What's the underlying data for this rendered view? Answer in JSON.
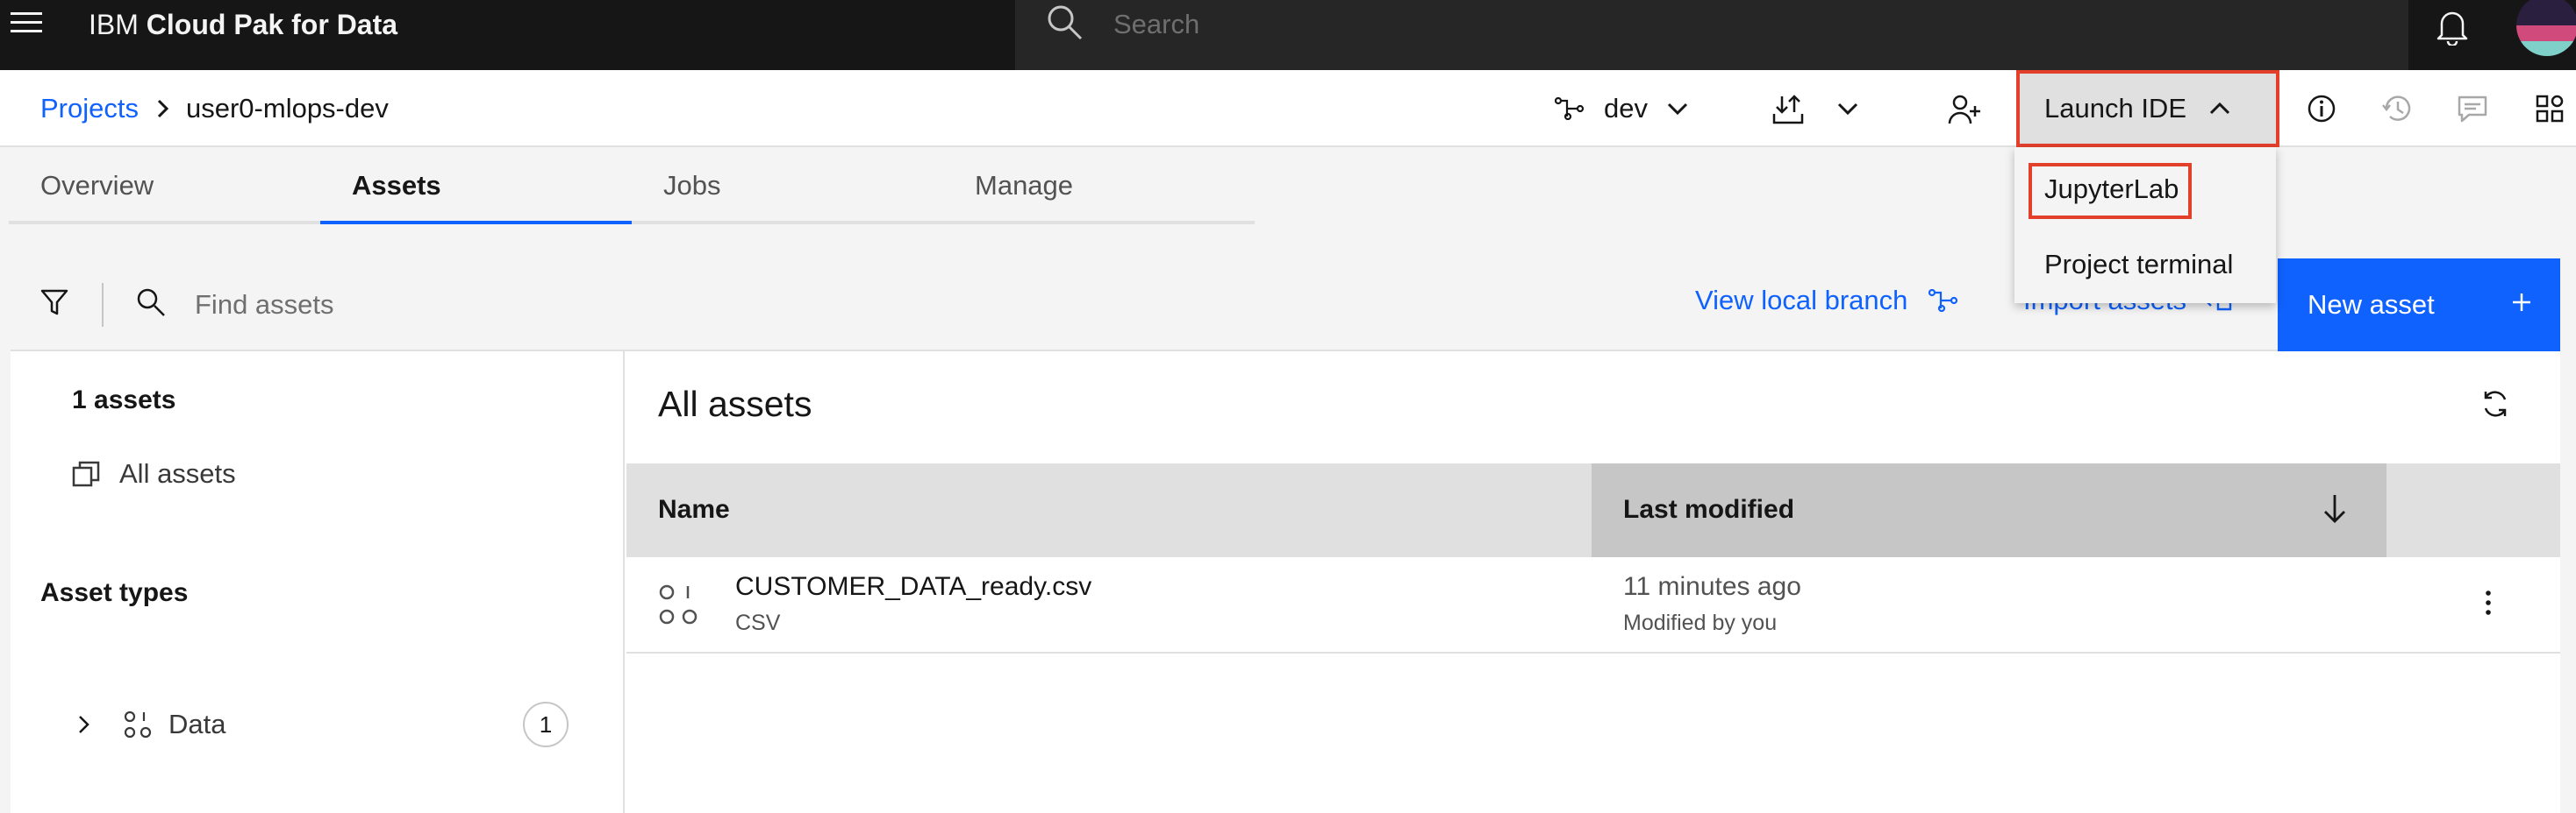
{
  "shell": {
    "brand_prefix": "IBM",
    "brand_name": "Cloud Pak for Data",
    "search_placeholder": "Search"
  },
  "breadcrumb": {
    "root": "Projects",
    "current": "user0-mlops-dev"
  },
  "header_actions": {
    "branch": "dev",
    "launch_ide": "Launch IDE"
  },
  "ide_menu": {
    "items": [
      "JupyterLab",
      "Project terminal"
    ],
    "highlighted": "JupyterLab"
  },
  "tabs": [
    {
      "label": "Overview",
      "active": false
    },
    {
      "label": "Assets",
      "active": true
    },
    {
      "label": "Jobs",
      "active": false
    },
    {
      "label": "Manage",
      "active": false
    }
  ],
  "toolbar": {
    "find_placeholder": "Find assets",
    "view_local_branch": "View local branch",
    "import_assets": "Import assets",
    "new_asset": "New asset"
  },
  "sidebar": {
    "count": "1 assets",
    "all_assets": "All assets",
    "types_heading": "Asset types",
    "types": [
      {
        "label": "Data",
        "count": "1"
      }
    ]
  },
  "assets": {
    "title": "All assets",
    "columns": {
      "name": "Name",
      "modified": "Last modified"
    },
    "rows": [
      {
        "name": "CUSTOMER_DATA_ready.csv",
        "type": "CSV",
        "modified": "11 minutes ago",
        "modified_by": "Modified by you"
      }
    ]
  },
  "colors": {
    "accent": "#0f62fe",
    "highlight": "#e3402c",
    "shell": "#161616"
  }
}
